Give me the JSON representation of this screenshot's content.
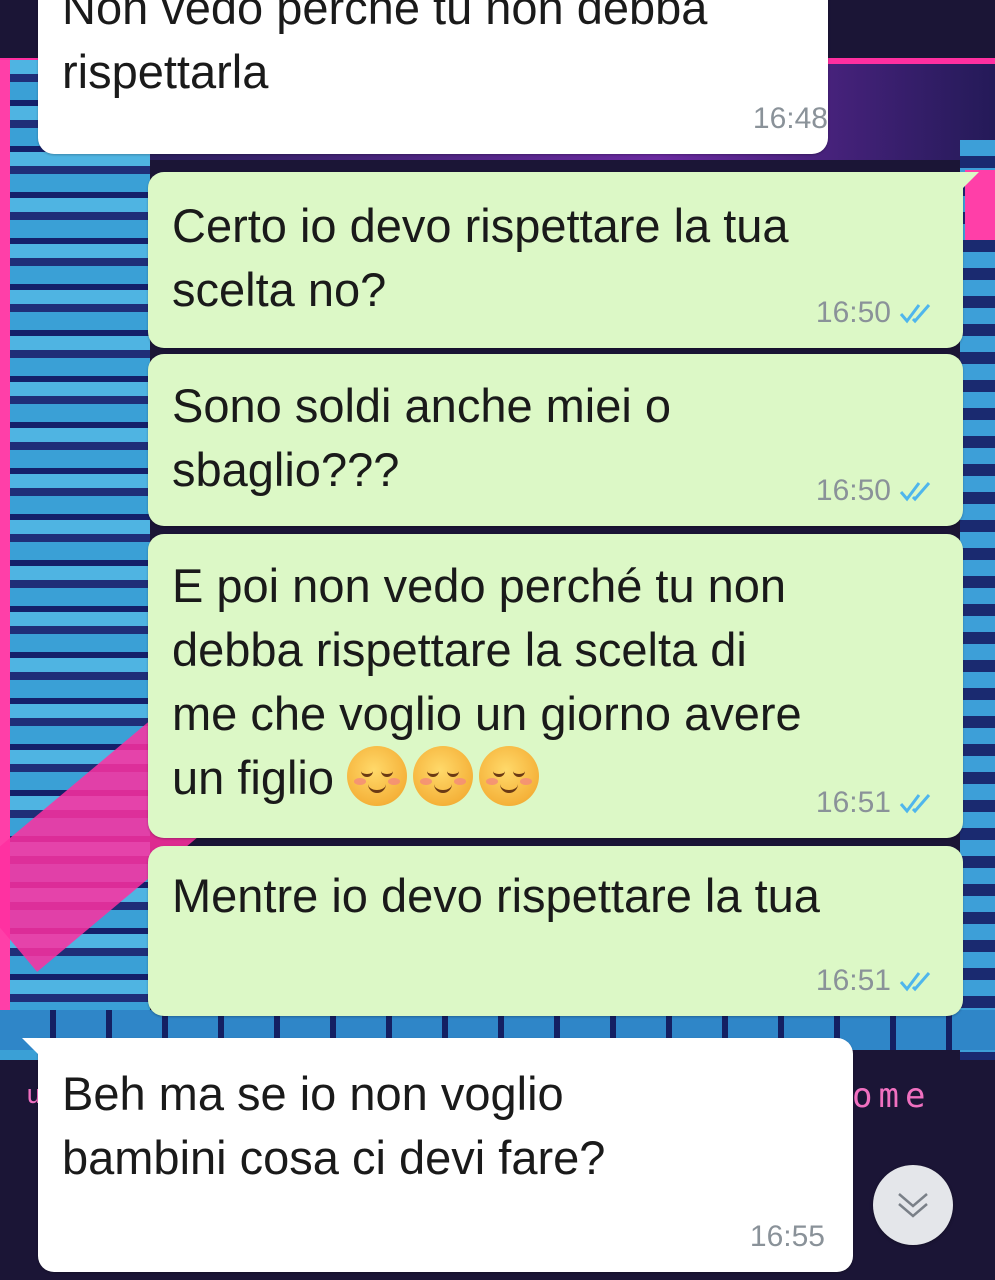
{
  "wallpaper": {
    "welcome_text": "ome",
    "welcome_left": "u"
  },
  "messages": [
    {
      "direction": "in",
      "text": "Non vedo perché tu non debba\nrispettarla",
      "time": "16:48"
    },
    {
      "direction": "out",
      "text": "Certo io devo rispettare la tua\nscelta no?",
      "time": "16:50",
      "status": "read"
    },
    {
      "direction": "out",
      "text": "Sono soldi anche miei o\nsbaglio???",
      "time": "16:50",
      "status": "read"
    },
    {
      "direction": "out",
      "text": "E poi non vedo perché tu non\ndebba rispettare la scelta di\nme che voglio un giorno avere\nun figlio ",
      "emoji": "☺☺☺",
      "emoji_name": "smiling-face-icon",
      "time": "16:51",
      "status": "read"
    },
    {
      "direction": "out",
      "text": "Mentre io devo rispettare la tua",
      "time": "16:51",
      "status": "read"
    },
    {
      "direction": "in",
      "text": "Beh ma se io non voglio\nbambini cosa ci devi fare?",
      "time": "16:55"
    }
  ],
  "colors": {
    "incoming": "#ffffff",
    "outgoing": "#dcf8c6",
    "read_tick": "#4fb6ec",
    "timestamp": "#8a9299"
  },
  "scroll_button_icon": "chevron-down-icon"
}
